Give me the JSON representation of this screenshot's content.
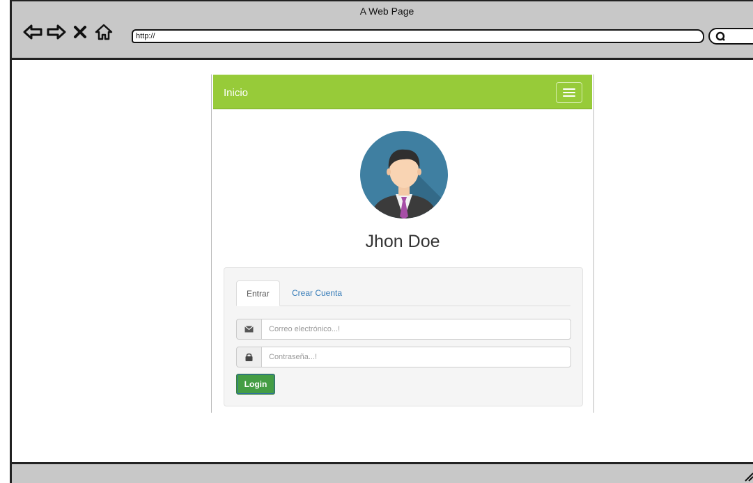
{
  "browser": {
    "window_title": "A Web Page",
    "url": "http://",
    "icons": [
      "back-arrow-icon",
      "forward-arrow-icon",
      "close-icon",
      "home-icon",
      "search-icon"
    ]
  },
  "app": {
    "navbar": {
      "brand": "Inicio",
      "background": "#97cb39",
      "menu_icon": "hamburger-icon"
    },
    "profile": {
      "name": "Jhon Doe",
      "avatar_icon": "user-avatar-icon"
    },
    "auth": {
      "tabs": [
        {
          "label": "Entrar",
          "active": true
        },
        {
          "label": "Crear Cuenta",
          "active": false
        }
      ],
      "email": {
        "placeholder": "Correo electrónico...!",
        "value": "",
        "icon": "envelope-icon"
      },
      "password": {
        "placeholder": "Contraseña...!",
        "value": "",
        "icon": "lock-icon"
      },
      "submit_label": "Login",
      "submit_color": "#449d44"
    }
  }
}
